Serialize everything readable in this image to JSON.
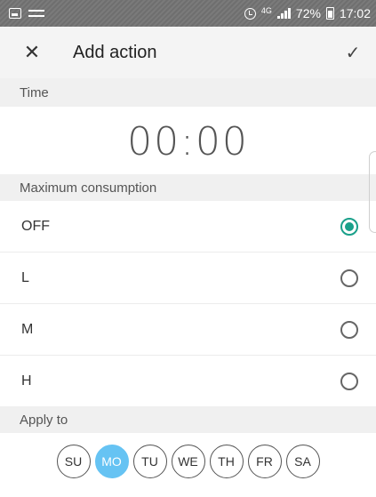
{
  "status_bar": {
    "network": "4G",
    "battery": "72%",
    "time": "17:02",
    "icons": [
      "gallery-icon",
      "news-icon",
      "alarm-icon",
      "signal-icon",
      "battery-icon"
    ]
  },
  "app_bar": {
    "close_label": "✕",
    "title": "Add action",
    "confirm_label": "✓"
  },
  "time_section": {
    "header": "Time",
    "value": "00:00"
  },
  "consumption_section": {
    "header": "Maximum consumption",
    "options": [
      {
        "label": "OFF",
        "selected": true
      },
      {
        "label": "L",
        "selected": false
      },
      {
        "label": "M",
        "selected": false
      },
      {
        "label": "H",
        "selected": false
      }
    ]
  },
  "apply_section": {
    "header": "Apply to",
    "days": [
      {
        "label": "SU",
        "selected": false
      },
      {
        "label": "MO",
        "selected": true
      },
      {
        "label": "TU",
        "selected": false
      },
      {
        "label": "WE",
        "selected": false
      },
      {
        "label": "TH",
        "selected": false
      },
      {
        "label": "FR",
        "selected": false
      },
      {
        "label": "SA",
        "selected": false
      }
    ]
  },
  "colors": {
    "accent_radio": "#1aa08a",
    "selected_day": "#66c3f3"
  }
}
